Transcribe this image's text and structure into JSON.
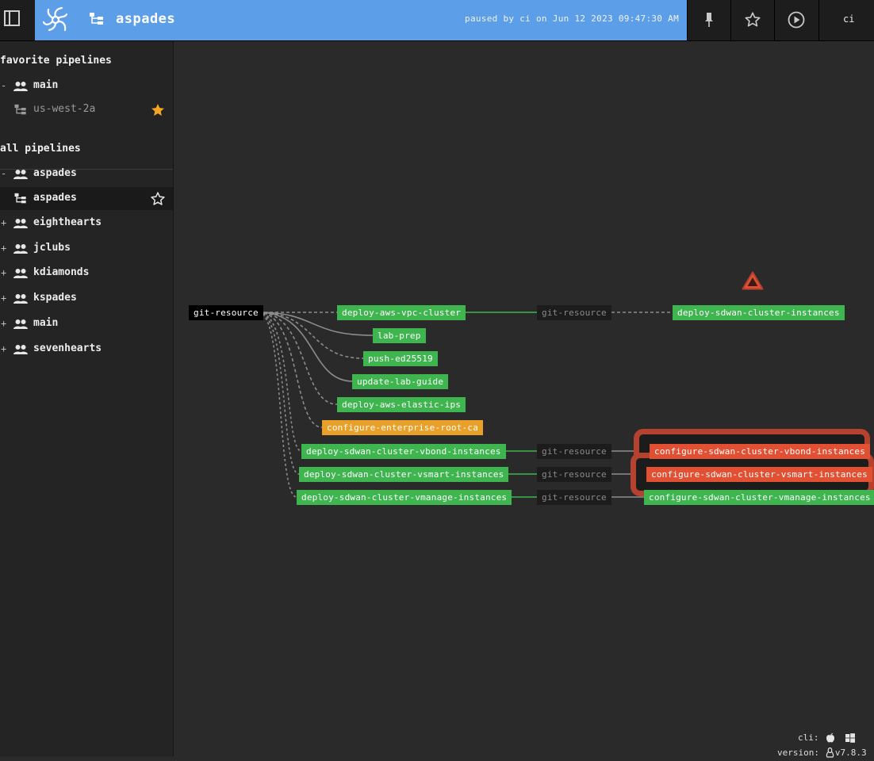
{
  "header": {
    "pipeline_name": "aspades",
    "paused_text": "paused by ci on Jun 12 2023 09:47:30 AM",
    "user": "ci",
    "accent_color": "#5c9fe8"
  },
  "sidebar": {
    "favorites_title": "favorite pipelines",
    "favorites": [
      {
        "team": "main",
        "toggle": "-",
        "pipelines": [
          {
            "name": "us-west-2a",
            "favorited": true
          }
        ]
      }
    ],
    "all_title": "all pipelines",
    "teams": [
      {
        "team": "aspades",
        "toggle": "-",
        "pipelines": [
          {
            "name": "aspades",
            "favorited": false,
            "selected": true
          }
        ]
      },
      {
        "team": "eighthearts",
        "toggle": "+"
      },
      {
        "team": "jclubs",
        "toggle": "+"
      },
      {
        "team": "kdiamonds",
        "toggle": "+"
      },
      {
        "team": "kspades",
        "toggle": "+"
      },
      {
        "team": "main",
        "toggle": "+"
      },
      {
        "team": "sevenhearts",
        "toggle": "+"
      }
    ]
  },
  "graph": {
    "source_resource": "git-resource",
    "jobs": {
      "deploy_aws_vpc_cluster": "deploy-aws-vpc-cluster",
      "lab_prep": "lab-prep",
      "push_ed25519": "push-ed25519",
      "update_lab_guide": "update-lab-guide",
      "deploy_aws_elastic_ips": "deploy-aws-elastic-ips",
      "configure_enterprise_root_ca": "configure-enterprise-root-ca",
      "deploy_vbond": "deploy-sdwan-cluster-vbond-instances",
      "deploy_vsmart": "deploy-sdwan-cluster-vsmart-instances",
      "deploy_vmanage": "deploy-sdwan-cluster-vmanage-instances",
      "deploy_sdwan_instances": "deploy-sdwan-cluster-instances",
      "configure_vbond": "configure-sdwan-cluster-vbond-instances",
      "configure_vsmart": "configure-sdwan-cluster-vsmart-instances",
      "configure_vmanage": "configure-sdwan-cluster-vmanage-instances"
    },
    "mid_resource": "git-resource",
    "colors": {
      "succeeded": "#3fb54f",
      "pending": "#e8a029",
      "failed": "#e25033",
      "error": "#b5412f"
    }
  },
  "footer": {
    "cli_label": "cli:",
    "version_label": "version:",
    "version": "v7.8.3"
  }
}
